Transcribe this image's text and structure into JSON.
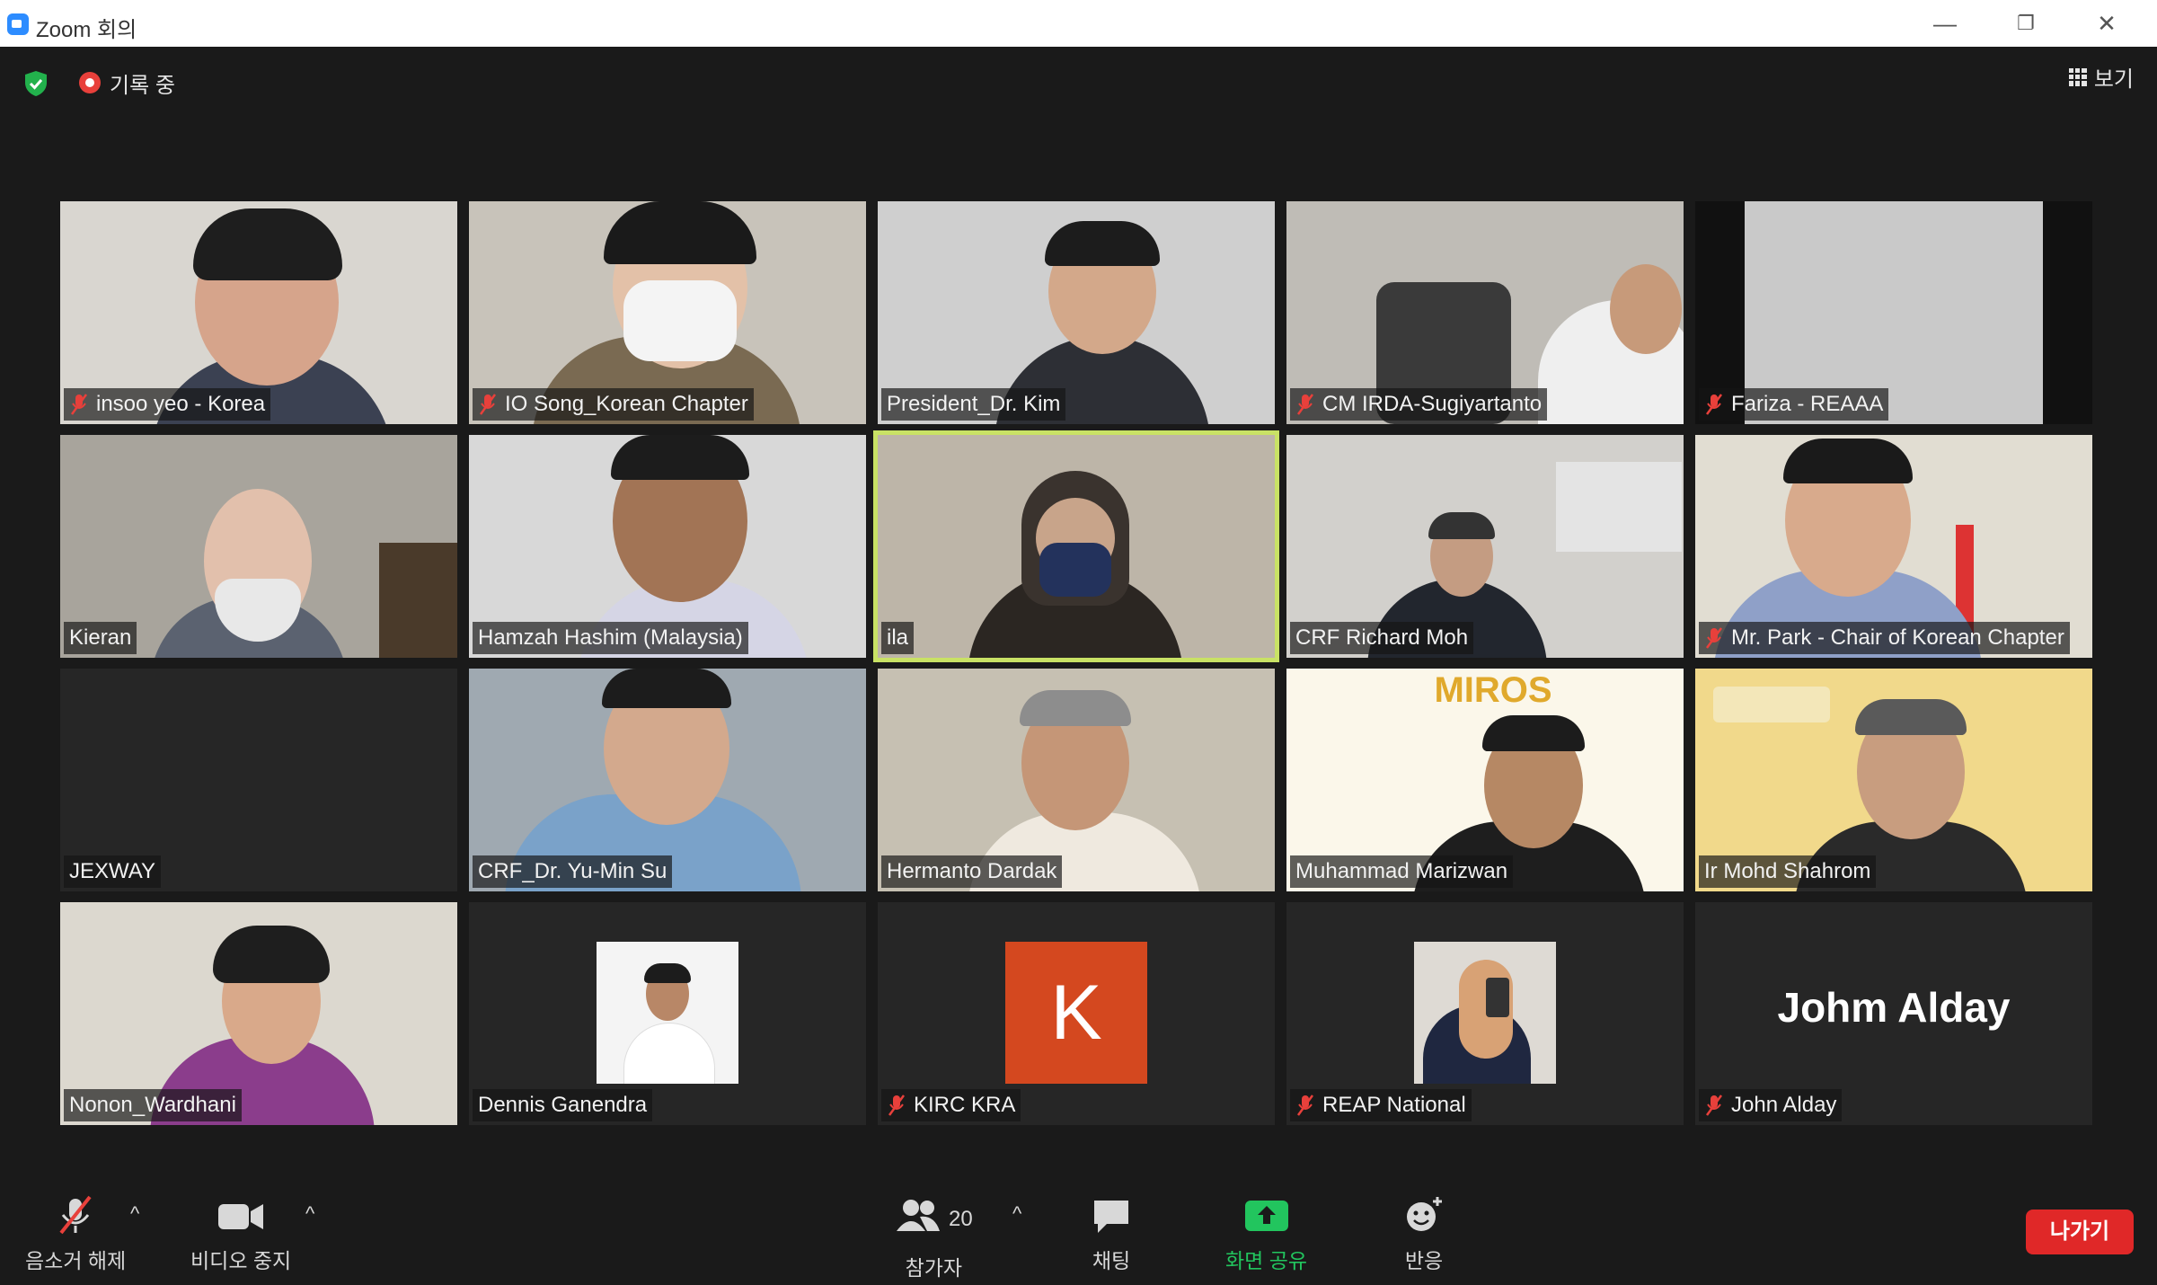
{
  "window": {
    "title": "Zoom 회의"
  },
  "header": {
    "recording_label": "기록 중",
    "view_label": "보기"
  },
  "participants": [
    {
      "name": "insoo yeo - Korea",
      "muted": true
    },
    {
      "name": "IO Song_Korean Chapter",
      "muted": true
    },
    {
      "name": "President_Dr. Kim",
      "muted": false
    },
    {
      "name": "CM IRDA-Sugiyartanto",
      "muted": true
    },
    {
      "name": "Fariza - REAAA",
      "muted": true
    },
    {
      "name": "Kieran",
      "muted": false
    },
    {
      "name": "Hamzah Hashim (Malaysia)",
      "muted": false
    },
    {
      "name": "ila",
      "muted": false,
      "active_speaker": true
    },
    {
      "name": "CRF Richard Moh",
      "muted": false
    },
    {
      "name": "Mr. Park - Chair of Korean Chapter",
      "muted": true
    },
    {
      "name": "JEXWAY",
      "muted": false
    },
    {
      "name": "CRF_Dr. Yu-Min Su",
      "muted": false
    },
    {
      "name": "Hermanto Dardak",
      "muted": false
    },
    {
      "name": "Muhammad Marizwan",
      "muted": false,
      "background_text": "MIROS"
    },
    {
      "name": "Ir Mohd Shahrom",
      "muted": false
    },
    {
      "name": "Nonon_Wardhani",
      "muted": false
    },
    {
      "name": "Dennis Ganendra",
      "muted": false
    },
    {
      "name": "KIRC KRA",
      "muted": true,
      "avatar_letter": "K"
    },
    {
      "name": "REAP National",
      "muted": true
    },
    {
      "name": "John Alday",
      "muted": true,
      "display_name": "Johm Alday"
    }
  ],
  "toolbar": {
    "unmute_label": "음소거 해제",
    "stop_video_label": "비디오 중지",
    "participants_label": "참가자",
    "participants_count": "20",
    "chat_label": "채팅",
    "share_label": "화면 공유",
    "reactions_label": "반응",
    "leave_label": "나가기"
  },
  "colors": {
    "stage_bg": "#1a1a1a",
    "active_outline": "#c9e265",
    "share_green": "#22c55e",
    "leave_red": "#e02828",
    "mute_red": "#e8403b",
    "k_avatar": "#d4481f"
  }
}
